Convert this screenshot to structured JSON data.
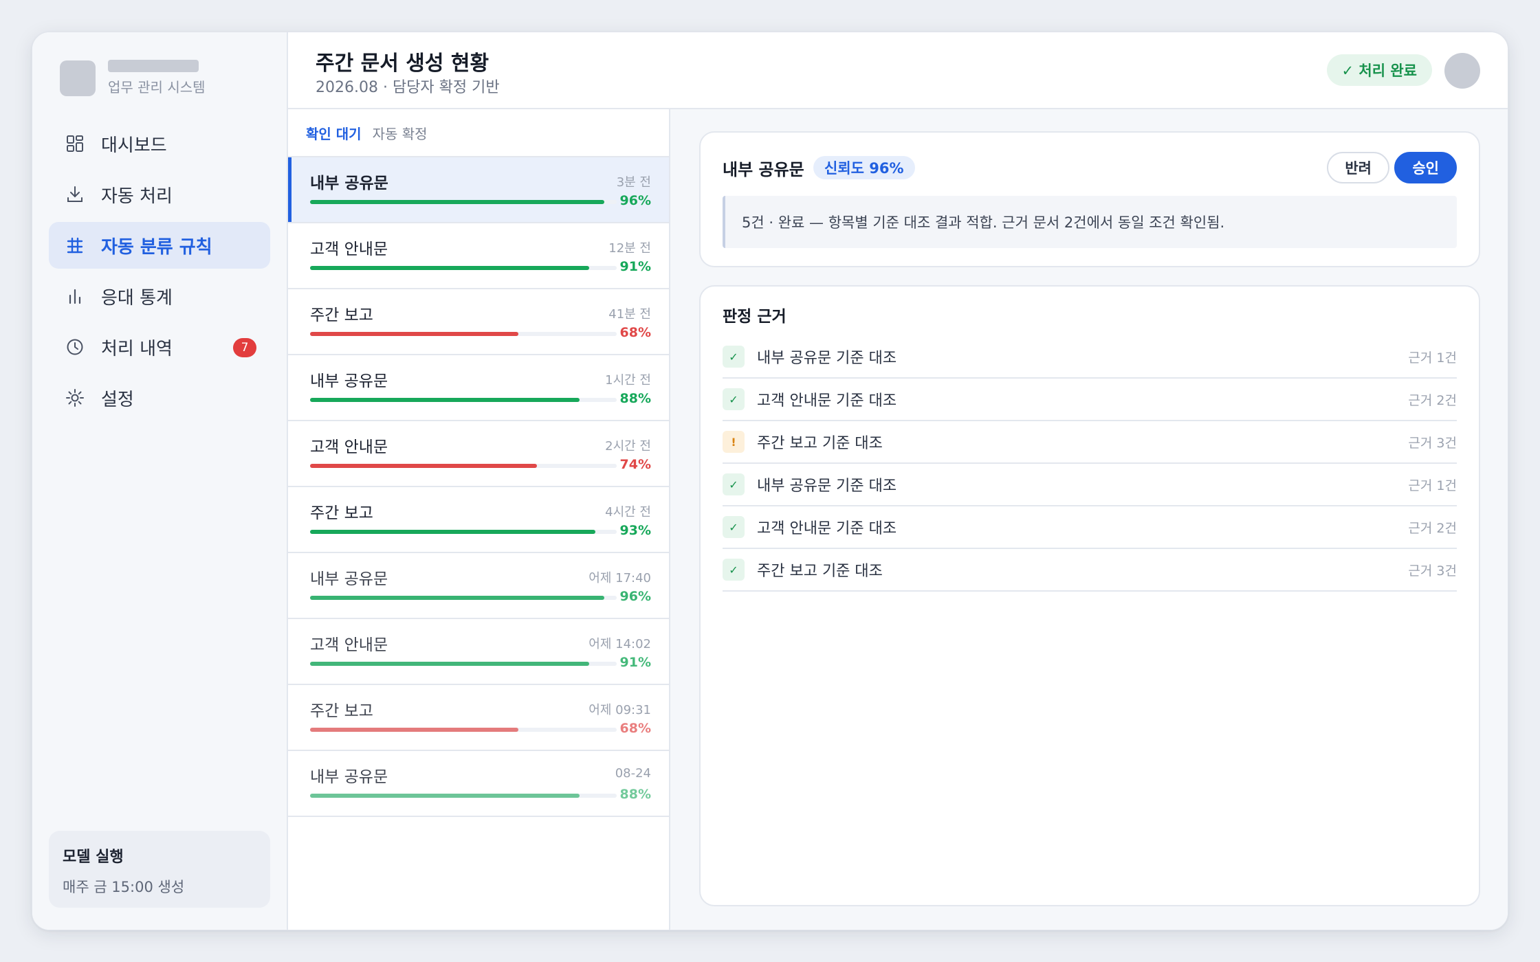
{
  "brand": {
    "subtitle": "업무 관리 시스템"
  },
  "nav": [
    {
      "label": "대시보드",
      "icon": "grid-icon",
      "active": false
    },
    {
      "label": "자동 처리",
      "icon": "download-icon",
      "active": false
    },
    {
      "label": "자동 분류 규칙",
      "icon": "table-icon",
      "active": true
    },
    {
      "label": "응대 통계",
      "icon": "bar-chart-icon",
      "active": false
    },
    {
      "label": "처리 내역",
      "icon": "clock-icon",
      "active": false,
      "badge": "7"
    },
    {
      "label": "설정",
      "icon": "gear-icon",
      "active": false
    }
  ],
  "model": {
    "title": "모델 실행",
    "schedule": "매주 금 15:00 생성"
  },
  "header": {
    "title": "주간 문서 생성 현황",
    "subtitle": "2026.08 · 담당자 확정 기반",
    "status": "✓ 처리 완료"
  },
  "tabs": {
    "active": "확인 대기",
    "other": "자동 확정"
  },
  "colors": {
    "accent": "#2160e0",
    "ok": "#17a85a",
    "bad": "#e04848"
  },
  "list": [
    {
      "title": "내부 공유문",
      "time": "3분 전",
      "pct": 0.96,
      "pct_label": "96%",
      "status": "ok",
      "selected": true
    },
    {
      "title": "고객 안내문",
      "time": "12분 전",
      "pct": 0.91,
      "pct_label": "91%",
      "status": "ok"
    },
    {
      "title": "주간 보고",
      "time": "41분 전",
      "pct": 0.68,
      "pct_label": "68%",
      "status": "bad"
    },
    {
      "title": "내부 공유문",
      "time": "1시간 전",
      "pct": 0.88,
      "pct_label": "88%",
      "status": "ok"
    },
    {
      "title": "고객 안내문",
      "time": "2시간 전",
      "pct": 0.74,
      "pct_label": "74%",
      "status": "bad"
    },
    {
      "title": "주간 보고",
      "time": "4시간 전",
      "pct": 0.93,
      "pct_label": "93%",
      "status": "ok"
    },
    {
      "title": "내부 공유문",
      "time": "어제 17:40",
      "pct": 0.96,
      "pct_label": "96%",
      "status": "ok"
    },
    {
      "title": "고객 안내문",
      "time": "어제 14:02",
      "pct": 0.91,
      "pct_label": "91%",
      "status": "ok"
    },
    {
      "title": "주간 보고",
      "time": "어제 09:31",
      "pct": 0.68,
      "pct_label": "68%",
      "status": "bad"
    },
    {
      "title": "내부 공유문",
      "time": "08-24",
      "pct": 0.88,
      "pct_label": "88%",
      "status": "ok"
    }
  ],
  "detail": {
    "title": "내부 공유문",
    "confidence": "신뢰도 96%",
    "reject_label": "반려",
    "approve_label": "승인",
    "summary": "5건 · 완료 — 항목별 기준 대조 결과 적합. 근거 문서 2건에서 동일 조건 확인됨.",
    "evidence_title": "판정 근거",
    "evidence": [
      {
        "label": "내부 공유문 기준 대조",
        "count": "근거 1건",
        "state": "ok",
        "glyph": "✓"
      },
      {
        "label": "고객 안내문 기준 대조",
        "count": "근거 2건",
        "state": "ok",
        "glyph": "✓"
      },
      {
        "label": "주간 보고 기준 대조",
        "count": "근거 3건",
        "state": "warn",
        "glyph": "!"
      },
      {
        "label": "내부 공유문 기준 대조",
        "count": "근거 1건",
        "state": "ok",
        "glyph": "✓"
      },
      {
        "label": "고객 안내문 기준 대조",
        "count": "근거 2건",
        "state": "ok",
        "glyph": "✓"
      },
      {
        "label": "주간 보고 기준 대조",
        "count": "근거 3건",
        "state": "ok",
        "glyph": "✓"
      }
    ]
  }
}
